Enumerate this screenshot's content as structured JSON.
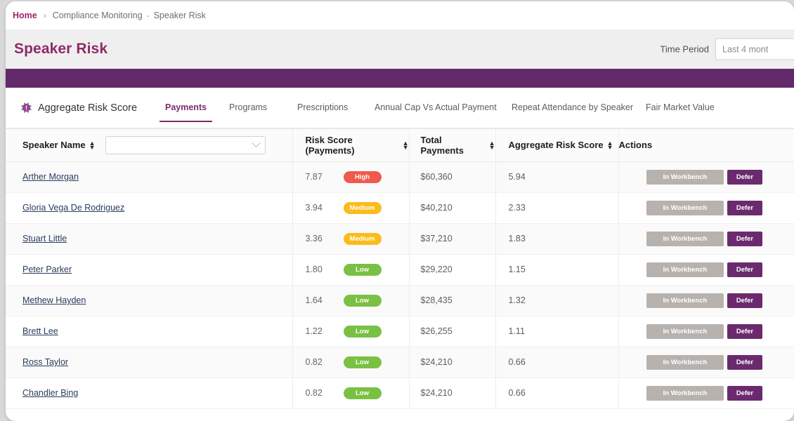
{
  "breadcrumb": {
    "home": "Home",
    "separator": "›",
    "middle": "Compliance Monitoring",
    "dash": "-",
    "last": "Speaker Risk"
  },
  "header": {
    "title": "Speaker Risk",
    "time_period_label": "Time Period",
    "time_period_value": "Last 4 mont"
  },
  "theme": {
    "brand_purple": "#63296b",
    "title_purple": "#8f2a66",
    "crumb_magenta": "#a0246e",
    "high": "#ef5a4c",
    "medium": "#fcbb1c",
    "low": "#7ac143",
    "defer_purple": "#6b2a6e",
    "workbench_grey": "#b7b2ad"
  },
  "tabs_section": {
    "aggregate_label": "Aggregate Risk Score",
    "gear_icon": "gear-icon",
    "tabs": [
      {
        "label": "Payments",
        "active": true
      },
      {
        "label": "Programs",
        "active": false
      },
      {
        "label": "Prescriptions",
        "active": false
      },
      {
        "label": "Annual Cap Vs Actual Payment",
        "active": false
      },
      {
        "label": "Repeat Attendance by Speaker",
        "active": false
      },
      {
        "label": "Fair Market Value",
        "active": false
      }
    ]
  },
  "table": {
    "columns": {
      "speaker_name": "Speaker Name",
      "risk_score": "Risk Score (Payments)",
      "total_payments": "Total Payments",
      "aggregate_risk_score": "Aggregate Risk Score",
      "actions": "Actions"
    },
    "name_filter_value": "",
    "name_filter_placeholder": "",
    "action_labels": {
      "workbench": "In Workbench",
      "defer": "Defer"
    },
    "rows": [
      {
        "name": "Arther Morgan",
        "risk": "7.87",
        "level": "High",
        "total": "$60,360",
        "agg": "5.94"
      },
      {
        "name": "Gloria Vega De Rodriguez",
        "risk": "3.94",
        "level": "Medium",
        "total": "$40,210",
        "agg": "2.33"
      },
      {
        "name": "Stuart Little",
        "risk": "3.36",
        "level": "Medium",
        "total": "$37,210",
        "agg": "1.83"
      },
      {
        "name": "Peter Parker",
        "risk": "1.80",
        "level": "Low",
        "total": "$29,220",
        "agg": "1.15"
      },
      {
        "name": "Methew Hayden",
        "risk": "1.64",
        "level": "Low",
        "total": "$28,435",
        "agg": "1.32"
      },
      {
        "name": "Brett Lee",
        "risk": "1.22",
        "level": "Low",
        "total": "$26,255",
        "agg": "1.11"
      },
      {
        "name": "Ross Taylor",
        "risk": "0.82",
        "level": "Low",
        "total": "$24,210",
        "agg": "0.66"
      },
      {
        "name": "Chandler Bing",
        "risk": "0.82",
        "level": "Low",
        "total": "$24,210",
        "agg": "0.66"
      }
    ]
  }
}
